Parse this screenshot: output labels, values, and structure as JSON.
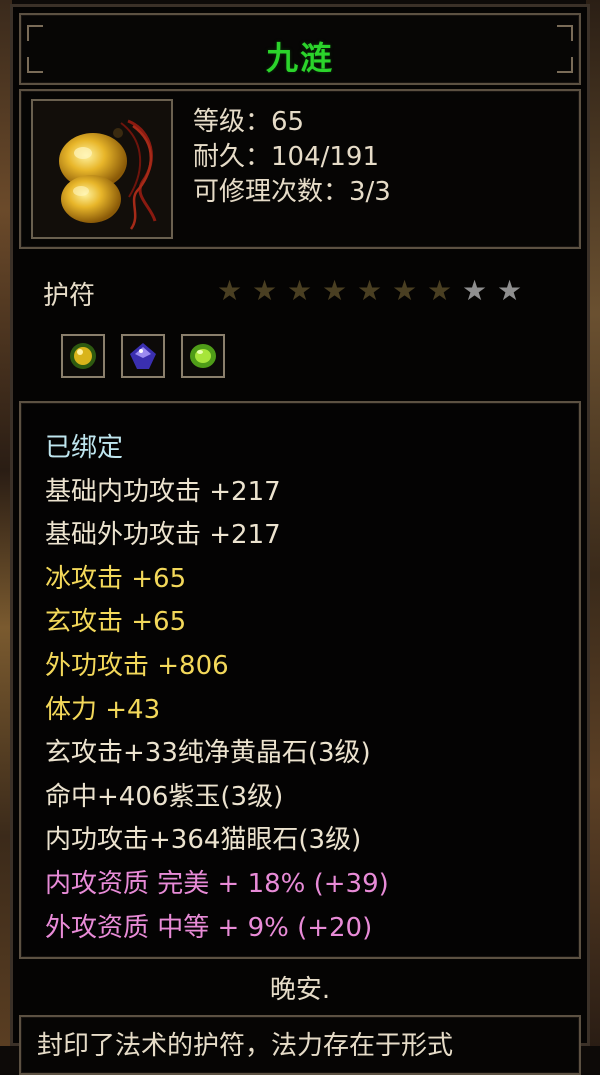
{
  "item": {
    "name": "九涟",
    "icon": "jade-amulet-icon",
    "level_line": "等级：65",
    "durability_line": "耐久：104/191",
    "repair_line": "可修理次数：3/3",
    "category": "护符",
    "stars": {
      "filled": 7,
      "total": 9
    },
    "gem_slots": [
      "yellow-crystal-gem-icon",
      "purple-jade-gem-icon",
      "cat-eye-gem-icon"
    ]
  },
  "stats": [
    {
      "text": "已绑定",
      "tone": "bound"
    },
    {
      "text": "基础内功攻击 +217",
      "tone": "white"
    },
    {
      "text": "基础外功攻击 +217",
      "tone": "white"
    },
    {
      "text": "冰攻击 +65",
      "tone": "yellow"
    },
    {
      "text": "玄攻击 +65",
      "tone": "yellow"
    },
    {
      "text": "外功攻击 +806",
      "tone": "yellow"
    },
    {
      "text": "体力 +43",
      "tone": "yellow"
    },
    {
      "text": "玄攻击+33纯净黄晶石(3级)",
      "tone": "white"
    },
    {
      "text": "命中+406紫玉(3级)",
      "tone": "white"
    },
    {
      "text": "内功攻击+364猫眼石(3级)",
      "tone": "white"
    },
    {
      "text": "内攻资质 完美 + 18% (+39)",
      "tone": "pink"
    },
    {
      "text": "外攻资质 中等 + 9% (+20)",
      "tone": "pink"
    }
  ],
  "nickname": "晚安.",
  "description": "封印了法术的护符，法力存在于形式",
  "colors": {
    "title": "#2bd42b",
    "bound": "#bfe6ef",
    "white": "#ece3cf",
    "yellow": "#f3d85a",
    "pink": "#e88bd7",
    "star_filled": "#4a3f22",
    "star_empty": "#8f8f8f"
  }
}
